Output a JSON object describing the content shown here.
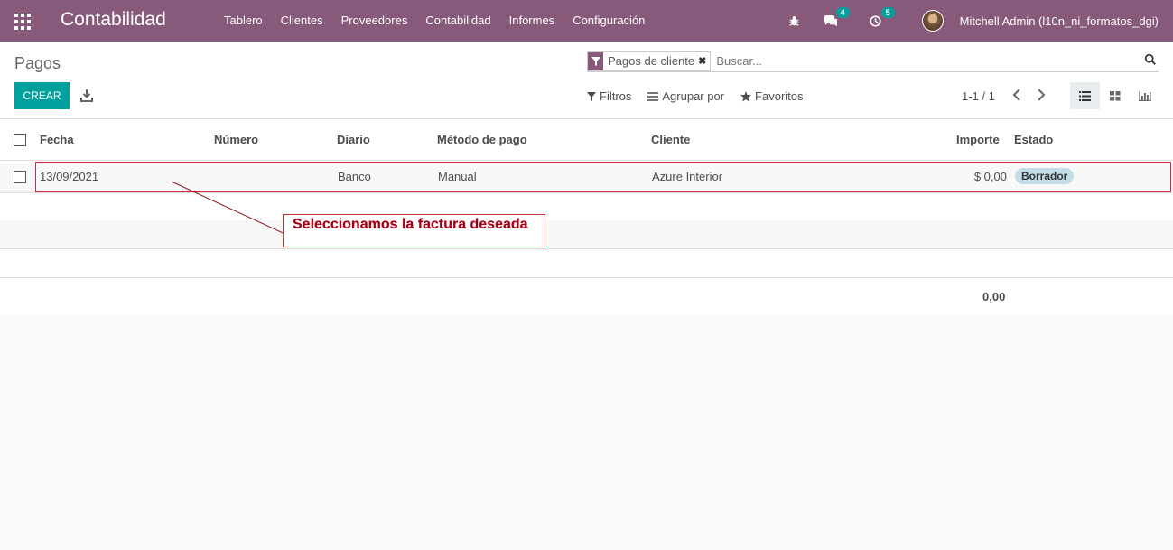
{
  "navbar": {
    "brand": "Contabilidad",
    "menu": [
      "Tablero",
      "Clientes",
      "Proveedores",
      "Contabilidad",
      "Informes",
      "Configuración"
    ],
    "messages_count": "4",
    "activities_count": "5",
    "user": "Mitchell Admin (l10n_ni_formatos_dgi)"
  },
  "control_panel": {
    "title": "Pagos",
    "facet": "Pagos de cliente",
    "search_placeholder": "Buscar...",
    "create_label": "CREAR",
    "filters_label": "Filtros",
    "group_by_label": "Agrupar por",
    "favorites_label": "Favoritos",
    "pager": "1-1 / 1"
  },
  "table": {
    "headers": {
      "fecha": "Fecha",
      "numero": "Número",
      "diario": "Diario",
      "metodo": "Método de pago",
      "cliente": "Cliente",
      "importe": "Importe",
      "estado": "Estado"
    },
    "rows": [
      {
        "fecha": "13/09/2021",
        "numero": "",
        "diario": "Banco",
        "metodo": "Manual",
        "cliente": "Azure Interior",
        "importe": "$ 0,00",
        "estado": "Borrador"
      }
    ],
    "total": "0,00"
  },
  "annotation": {
    "text": "Seleccionamos la factura deseada",
    "color": "#a0001a"
  },
  "colors": {
    "brand": "#875a7b",
    "primary": "#00a09d"
  }
}
